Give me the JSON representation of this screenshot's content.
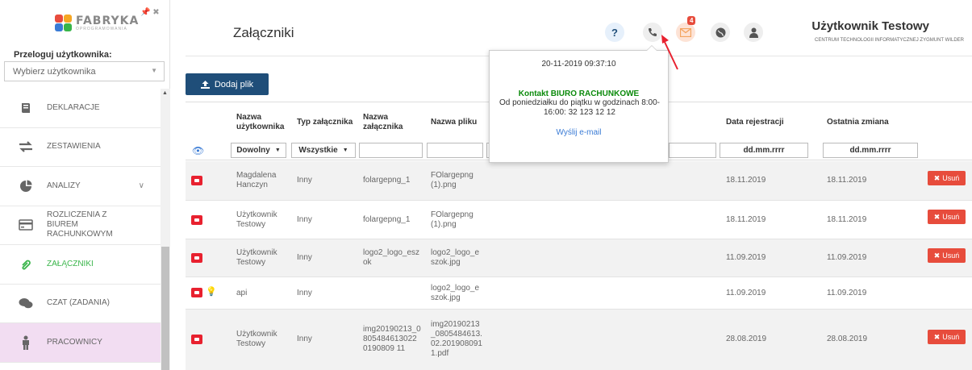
{
  "sidebar": {
    "logo_text": "FABRYKA",
    "logo_sub": "OPROGRAMOWANIA",
    "switch_label": "Przeloguj użytkownika:",
    "user_select_placeholder": "Wybierz użytkownika",
    "items": [
      {
        "label": "DEKLARACJE",
        "icon": "book-icon"
      },
      {
        "label": "ZESTAWIENIA",
        "icon": "exchange-icon"
      },
      {
        "label": "ANALIZY",
        "icon": "pie-chart-icon"
      },
      {
        "label": "ROZLICZENIA Z BIUREM RACHUNKOWYM",
        "icon": "credit-card-icon"
      },
      {
        "label": "ZAŁĄCZNIKI",
        "icon": "paperclip-icon"
      },
      {
        "label": "CZAT (ZADANIA)",
        "icon": "chat-icon"
      },
      {
        "label": "PRACOWNICY",
        "icon": "person-icon"
      }
    ]
  },
  "header": {
    "title": "Załączniki",
    "mail_badge": "4",
    "help_label": "?",
    "user_name": "Użytkownik Testowy",
    "user_org": "CENTRUM TECHNOLOGII INFORMATYCZNEJ ZYGMUNT WILDER"
  },
  "add_button_label": "Dodaj plik",
  "table": {
    "headers": {
      "user": "Nazwa użytkownika",
      "type": "Typ załącznika",
      "att_name": "Nazwa załącznika",
      "file_name": "Nazwa pliku",
      "reg_date": "Data rejestracji",
      "last_change": "Ostatnia zmiana"
    },
    "filters": {
      "user": "Dowolny",
      "type": "Wszystkie",
      "reg_date": "dd.mm.rrrr",
      "last_change": "dd.mm.rrrr"
    },
    "delete_label": "Usuń",
    "rows": [
      {
        "user": "Magdalena Hanczyn",
        "type": "Inny",
        "att_name": "folargepng_1",
        "file_name": "FOlargepng (1).png",
        "reg_date": "18.11.2019",
        "last_change": "18.11.2019"
      },
      {
        "user": "Użytkownik Testowy",
        "type": "Inny",
        "att_name": "folargepng_1",
        "file_name": "FOlargepng (1).png",
        "reg_date": "18.11.2019",
        "last_change": "18.11.2019"
      },
      {
        "user": "Użytkownik Testowy",
        "type": "Inny",
        "att_name": "logo2_logo_eszok",
        "file_name": "logo2_logo_eszok.jpg",
        "reg_date": "11.09.2019",
        "last_change": "11.09.2019"
      },
      {
        "user": "api",
        "type": "Inny",
        "att_name": "",
        "file_name": "logo2_logo_eszok.jpg",
        "reg_date": "11.09.2019",
        "last_change": "11.09.2019"
      },
      {
        "user": "Użytkownik Testowy",
        "type": "Inny",
        "att_name": "img20190213_08054846130220190809 11",
        "file_name": "img20190213_0805484613.02.2019080911.pdf",
        "reg_date": "28.08.2019",
        "last_change": "28.08.2019"
      }
    ]
  },
  "popover": {
    "date": "20-11-2019 09:37:10",
    "title": "Kontakt BIURO RACHUNKOWE",
    "text": "Od poniedziałku do piątku w godzinach 8:00-16:00: 32 123 12 12",
    "link": "Wyślij e-mail"
  },
  "colors": {
    "accent_green": "#39b54a",
    "primary_blue": "#1f4e79",
    "danger_red": "#e74c3c",
    "highlight_pink": "#f2ddf2"
  }
}
